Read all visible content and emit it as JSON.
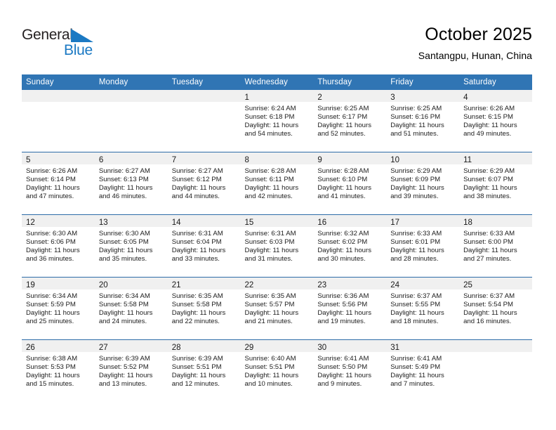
{
  "brand": {
    "name_top": "General",
    "name_bottom": "Blue",
    "accent_color": "#1b79c3"
  },
  "header": {
    "title": "October 2025",
    "location": "Santangpu, Hunan, China"
  },
  "theme": {
    "header_blue": "#3075b4",
    "divider_blue": "#2d6ca8",
    "daynum_band": "#f0f0f0"
  },
  "weekdays": [
    "Sunday",
    "Monday",
    "Tuesday",
    "Wednesday",
    "Thursday",
    "Friday",
    "Saturday"
  ],
  "weeks": [
    [
      {
        "day": ""
      },
      {
        "day": ""
      },
      {
        "day": ""
      },
      {
        "day": "1",
        "sunrise": "Sunrise: 6:24 AM",
        "sunset": "Sunset: 6:18 PM",
        "daylight1": "Daylight: 11 hours",
        "daylight2": "and 54 minutes."
      },
      {
        "day": "2",
        "sunrise": "Sunrise: 6:25 AM",
        "sunset": "Sunset: 6:17 PM",
        "daylight1": "Daylight: 11 hours",
        "daylight2": "and 52 minutes."
      },
      {
        "day": "3",
        "sunrise": "Sunrise: 6:25 AM",
        "sunset": "Sunset: 6:16 PM",
        "daylight1": "Daylight: 11 hours",
        "daylight2": "and 51 minutes."
      },
      {
        "day": "4",
        "sunrise": "Sunrise: 6:26 AM",
        "sunset": "Sunset: 6:15 PM",
        "daylight1": "Daylight: 11 hours",
        "daylight2": "and 49 minutes."
      }
    ],
    [
      {
        "day": "5",
        "sunrise": "Sunrise: 6:26 AM",
        "sunset": "Sunset: 6:14 PM",
        "daylight1": "Daylight: 11 hours",
        "daylight2": "and 47 minutes."
      },
      {
        "day": "6",
        "sunrise": "Sunrise: 6:27 AM",
        "sunset": "Sunset: 6:13 PM",
        "daylight1": "Daylight: 11 hours",
        "daylight2": "and 46 minutes."
      },
      {
        "day": "7",
        "sunrise": "Sunrise: 6:27 AM",
        "sunset": "Sunset: 6:12 PM",
        "daylight1": "Daylight: 11 hours",
        "daylight2": "and 44 minutes."
      },
      {
        "day": "8",
        "sunrise": "Sunrise: 6:28 AM",
        "sunset": "Sunset: 6:11 PM",
        "daylight1": "Daylight: 11 hours",
        "daylight2": "and 42 minutes."
      },
      {
        "day": "9",
        "sunrise": "Sunrise: 6:28 AM",
        "sunset": "Sunset: 6:10 PM",
        "daylight1": "Daylight: 11 hours",
        "daylight2": "and 41 minutes."
      },
      {
        "day": "10",
        "sunrise": "Sunrise: 6:29 AM",
        "sunset": "Sunset: 6:09 PM",
        "daylight1": "Daylight: 11 hours",
        "daylight2": "and 39 minutes."
      },
      {
        "day": "11",
        "sunrise": "Sunrise: 6:29 AM",
        "sunset": "Sunset: 6:07 PM",
        "daylight1": "Daylight: 11 hours",
        "daylight2": "and 38 minutes."
      }
    ],
    [
      {
        "day": "12",
        "sunrise": "Sunrise: 6:30 AM",
        "sunset": "Sunset: 6:06 PM",
        "daylight1": "Daylight: 11 hours",
        "daylight2": "and 36 minutes."
      },
      {
        "day": "13",
        "sunrise": "Sunrise: 6:30 AM",
        "sunset": "Sunset: 6:05 PM",
        "daylight1": "Daylight: 11 hours",
        "daylight2": "and 35 minutes."
      },
      {
        "day": "14",
        "sunrise": "Sunrise: 6:31 AM",
        "sunset": "Sunset: 6:04 PM",
        "daylight1": "Daylight: 11 hours",
        "daylight2": "and 33 minutes."
      },
      {
        "day": "15",
        "sunrise": "Sunrise: 6:31 AM",
        "sunset": "Sunset: 6:03 PM",
        "daylight1": "Daylight: 11 hours",
        "daylight2": "and 31 minutes."
      },
      {
        "day": "16",
        "sunrise": "Sunrise: 6:32 AM",
        "sunset": "Sunset: 6:02 PM",
        "daylight1": "Daylight: 11 hours",
        "daylight2": "and 30 minutes."
      },
      {
        "day": "17",
        "sunrise": "Sunrise: 6:33 AM",
        "sunset": "Sunset: 6:01 PM",
        "daylight1": "Daylight: 11 hours",
        "daylight2": "and 28 minutes."
      },
      {
        "day": "18",
        "sunrise": "Sunrise: 6:33 AM",
        "sunset": "Sunset: 6:00 PM",
        "daylight1": "Daylight: 11 hours",
        "daylight2": "and 27 minutes."
      }
    ],
    [
      {
        "day": "19",
        "sunrise": "Sunrise: 6:34 AM",
        "sunset": "Sunset: 5:59 PM",
        "daylight1": "Daylight: 11 hours",
        "daylight2": "and 25 minutes."
      },
      {
        "day": "20",
        "sunrise": "Sunrise: 6:34 AM",
        "sunset": "Sunset: 5:58 PM",
        "daylight1": "Daylight: 11 hours",
        "daylight2": "and 24 minutes."
      },
      {
        "day": "21",
        "sunrise": "Sunrise: 6:35 AM",
        "sunset": "Sunset: 5:58 PM",
        "daylight1": "Daylight: 11 hours",
        "daylight2": "and 22 minutes."
      },
      {
        "day": "22",
        "sunrise": "Sunrise: 6:35 AM",
        "sunset": "Sunset: 5:57 PM",
        "daylight1": "Daylight: 11 hours",
        "daylight2": "and 21 minutes."
      },
      {
        "day": "23",
        "sunrise": "Sunrise: 6:36 AM",
        "sunset": "Sunset: 5:56 PM",
        "daylight1": "Daylight: 11 hours",
        "daylight2": "and 19 minutes."
      },
      {
        "day": "24",
        "sunrise": "Sunrise: 6:37 AM",
        "sunset": "Sunset: 5:55 PM",
        "daylight1": "Daylight: 11 hours",
        "daylight2": "and 18 minutes."
      },
      {
        "day": "25",
        "sunrise": "Sunrise: 6:37 AM",
        "sunset": "Sunset: 5:54 PM",
        "daylight1": "Daylight: 11 hours",
        "daylight2": "and 16 minutes."
      }
    ],
    [
      {
        "day": "26",
        "sunrise": "Sunrise: 6:38 AM",
        "sunset": "Sunset: 5:53 PM",
        "daylight1": "Daylight: 11 hours",
        "daylight2": "and 15 minutes."
      },
      {
        "day": "27",
        "sunrise": "Sunrise: 6:39 AM",
        "sunset": "Sunset: 5:52 PM",
        "daylight1": "Daylight: 11 hours",
        "daylight2": "and 13 minutes."
      },
      {
        "day": "28",
        "sunrise": "Sunrise: 6:39 AM",
        "sunset": "Sunset: 5:51 PM",
        "daylight1": "Daylight: 11 hours",
        "daylight2": "and 12 minutes."
      },
      {
        "day": "29",
        "sunrise": "Sunrise: 6:40 AM",
        "sunset": "Sunset: 5:51 PM",
        "daylight1": "Daylight: 11 hours",
        "daylight2": "and 10 minutes."
      },
      {
        "day": "30",
        "sunrise": "Sunrise: 6:41 AM",
        "sunset": "Sunset: 5:50 PM",
        "daylight1": "Daylight: 11 hours",
        "daylight2": "and 9 minutes."
      },
      {
        "day": "31",
        "sunrise": "Sunrise: 6:41 AM",
        "sunset": "Sunset: 5:49 PM",
        "daylight1": "Daylight: 11 hours",
        "daylight2": "and 7 minutes."
      },
      {
        "day": ""
      }
    ]
  ]
}
